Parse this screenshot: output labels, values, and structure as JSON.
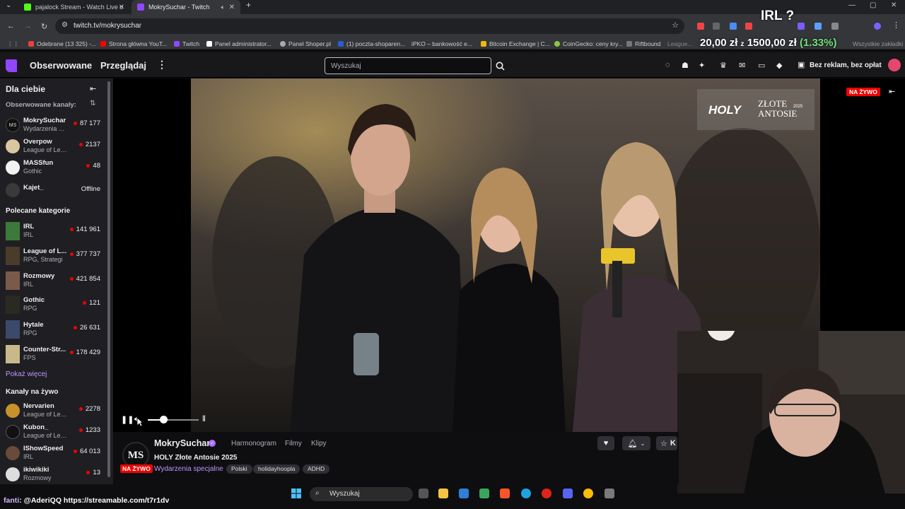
{
  "browser": {
    "tabs": [
      {
        "title": "pajalock Stream - Watch Live o",
        "close": "✕"
      },
      {
        "title": "MokrySuchar - Twitch",
        "close": "✕"
      }
    ],
    "new_tab": "+",
    "url": "twitch.tv/mokrysuchar",
    "bookmarks": [
      "Odebrane (13 325) -...",
      "Strona główna YouT...",
      "Twitch",
      "Panel administrator...",
      "Panel Shoper.pl",
      "(1) poczta-shoparen...",
      "iPKO – bankowość e...",
      "Bitcoin Exchange | C...",
      "CoinGecko: ceny kry...",
      "Riftbound",
      "League...",
      "Wszystkie zakładki"
    ],
    "colors": {
      "chrome_dark": "#202124",
      "chrome_mid": "#35363a"
    }
  },
  "stream_overlays": {
    "irl_text": "IRL ?",
    "price_text": "20,00 zł",
    "price_sep": "z",
    "price_goal": "1500,00 zł",
    "price_pct": "(1.33%)"
  },
  "twitch_nav": {
    "following": "Obserwowane",
    "browse": "Przeglądaj",
    "more": "⋮",
    "search_placeholder": "Wyszukaj",
    "ad_free": "Bez reklam, bez opłat",
    "accent": "#9146ff"
  },
  "sidebar": {
    "header": "Dla ciebie",
    "followed_label": "Obserwowane kanały:",
    "followed": [
      {
        "name": "MokrySuchar",
        "game": "Wydarzenia ...",
        "viewers": "87 177",
        "live": true
      },
      {
        "name": "Overpow",
        "game": "League of Leg...",
        "viewers": "2137",
        "live": true
      },
      {
        "name": "MASSfun",
        "game": "Gothic",
        "viewers": "48",
        "live": true
      },
      {
        "name": "Kajet_",
        "game": "",
        "viewers": "Offline",
        "live": false
      }
    ],
    "recommended_label": "Polecane kategorie",
    "categories": [
      {
        "name": "IRL",
        "tags": "IRL",
        "viewers": "141 961"
      },
      {
        "name": "League of L...",
        "tags": "RPG, Strategi",
        "viewers": "377 737"
      },
      {
        "name": "Rozmowy",
        "tags": "IRL",
        "viewers": "421 854"
      },
      {
        "name": "Gothic",
        "tags": "RPG",
        "viewers": "121"
      },
      {
        "name": "Hytale",
        "tags": "RPG",
        "viewers": "26 631"
      },
      {
        "name": "Counter-Str...",
        "tags": "FPS",
        "viewers": "178 429"
      }
    ],
    "show_more": "Pokaż więcej",
    "live_label": "Kanały na żywo",
    "live_channels": [
      {
        "name": "Nervarien",
        "game": "League of Leg...",
        "viewers": "2278"
      },
      {
        "name": "Kubon_",
        "game": "League of Leg...",
        "viewers": "1233"
      },
      {
        "name": "IShowSpeed",
        "game": "IRL",
        "viewers": "64 013"
      },
      {
        "name": "ikiwikiki",
        "game": "Rozmowy",
        "viewers": "13"
      }
    ]
  },
  "player": {
    "live_badge": "NA ŻYWO",
    "logo_holy": "HOLY",
    "logo_title": "ZŁOTE ANTOSIE",
    "logo_year": "2025",
    "volume_level": 0.3
  },
  "channel": {
    "avatar_text": "MS",
    "live_badge": "NA ŻYWO",
    "name": "MokrySuchar",
    "tabs": [
      "Harmonogram",
      "Filmy",
      "Klipy"
    ],
    "title": "HOLY Złote Antosie 2025",
    "category": "Wydarzenia specjalne",
    "tags": [
      "Polski",
      "holidayhoopla",
      "ADHD"
    ],
    "follow_partial": "K"
  },
  "chat_line": {
    "user": "fanti",
    "message": ": @AderiQQ https://streamable.com/t7r1dv"
  },
  "taskbar": {
    "search_label": "Wyszukaj"
  }
}
